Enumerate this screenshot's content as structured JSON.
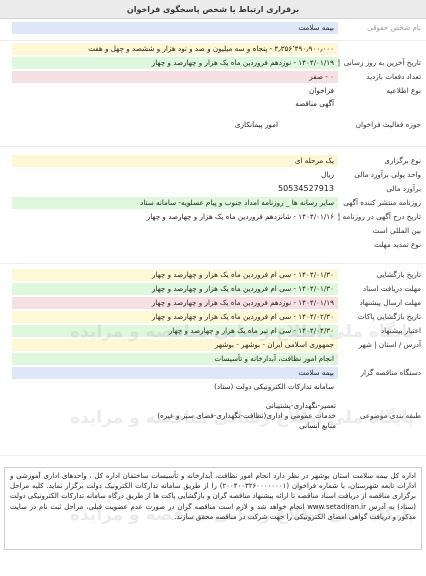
{
  "header": {
    "title": "برقراری ارتباط با شخص پاسخگوی فراخوان"
  },
  "fields": {
    "legal_name": {
      "label": "نام شخص حقوقی",
      "value": "بیمه سلامت"
    },
    "estimated_amount": {
      "label": "",
      "value": "۴٫۳۵۶٬۴۹۰٫۹۰۰٫۰۰۰ - پنجاه و سه میلیون و صد و نود هزار و ششصد و چهل و هفت"
    },
    "last_change": {
      "label": "تاریخ آخرین به روز رسانی",
      "value": "۱۴۰۴/۰۱/۱۹ - نوزدهم فروردین ماه یک هزار و چهارصد و چهار"
    },
    "tender_count": {
      "label": "تعداد دفعات بازدید",
      "value": "۰ - صفر"
    },
    "call_type": {
      "label": "نوع اطلاعیه",
      "value": "فراخوان"
    },
    "notice_type": {
      "label": "",
      "value": "آگهی مناقصه"
    },
    "activity": {
      "label": "حوزه فعالیت فراخوان",
      "value": "امور پیمانکاری"
    },
    "holding_type": {
      "label": "نوع برگزاری",
      "value": "یک مرحله ای"
    },
    "currency": {
      "label": "واحد پولی برآورد مالی",
      "value": "ریال"
    },
    "estimate": {
      "label": "برآورد مالی",
      "value": "50534527913"
    },
    "newspapers": {
      "label": "روزنامه منتشر کننده آگهی",
      "value": "سایر رسانه ها _ روزنامه امداد جنوب و پیام عسلویه- سامانه ستاد"
    },
    "publish_date": {
      "label": "تاریخ درج آگهی در روزنامه",
      "value": "۱۴۰۴/۰۱/۱۶ - شانزدهم فروردین ماه یک هزار و چهارصد و چهار"
    },
    "international": {
      "label": "بین المللی است",
      "value": ""
    },
    "deadline_type": {
      "label": "نوع تمدید مهلت",
      "value": ""
    },
    "doc_receive": {
      "label": "تاریخ بازگشایی",
      "value": "۱۴۰۴/۰۱/۳۰ - سی ام فروردین ماه یک هزار و چهارصد و چهار"
    },
    "doc_deadline": {
      "label": "مهلت دریافت اسناد",
      "value": "۱۴۰۴/۰۱/۳۰ - سی ام فروردین ماه یک هزار و چهارصد و چهار"
    },
    "offer_deadline": {
      "label": "مهلت ارسال پیشنهاد",
      "value": "۱۴۰۴/۰۱/۱۹ - نوزدهم فروردین ماه یک هزار و چهارصد و چهار"
    },
    "opening": {
      "label": "تاریخ بازگشایی پاکات",
      "value": "۱۴۰۴/۰۲/۳۰ - سی ام فروردین ماه یک هزار و چهارصد و چهار"
    },
    "validity": {
      "label": "اعتبار پیشنهاد",
      "value": "۱۴۰۴/۰۴/۳۰ - سی ام تیر ماه یک هزار و چهارصد و چهار"
    },
    "province": {
      "label": "آدرس / استان | شهر",
      "value": "جمهوری اسلامی ایران - بوشهر - بوشهر"
    },
    "executor": {
      "label": "",
      "value": "انجام امور نظافت، آبدارخانه و تأسیسات"
    },
    "agency": {
      "label": "دستگاه مناقصه گزار",
      "value": "بیمه سلامت"
    },
    "system": {
      "label": "",
      "value": "سامانه تدارکات الکترونیکی دولت (ستاد)"
    }
  },
  "category": {
    "label": "طبقه بندی موضوعی",
    "lines": [
      "تعمیر-نگهداری-پشتیبانی",
      "خدمات عمومی و اداری(نظافت-نگهداری-فضای سبز و غیره)",
      "منابع انسانی"
    ]
  },
  "description": "اداره کل بیمه سلامت استان بوشهر در نظر دارد انجام امور نظافت، آبدارخانه و تأسیسات ساختمان اداره کل ، واحدهای اداری آموزشی و ادارات تابعه شهرستان، با شماره فراخوان (۲۰۰۴۰۰۳۲۶۰۰۰۰۰۰۰۱) را از طریق سامانه تدارکات الکترونیک دولت برگزار نماید. کلیه مراحل برگزاری مناقصه از دریافت اسناد مناقصه تا ارائه پیشنهاد مناقصه گران و بازگشایی پاکت ها از طریق درگاه سامانه تدارکات الکترونیکی دولت (ستاد) به آدرس www.setadiran.ir انجام خواهد شد و لازم است مناقصه گران در صورت عدم عضویت قبلی، مراحل ثبت نام در سایت مذکور و دریافت گواهی امضای الکترونیکی را جهت شرکت در مناقصه محقق سازند.",
  "watermark": "پایگاه ملی اطلاع رسانی مناقصه و مزایده",
  "colors": {
    "yellow": "#fff8d6",
    "green": "#dff7dd",
    "pink": "#f7e0e4",
    "blue": "#dde7f7"
  }
}
